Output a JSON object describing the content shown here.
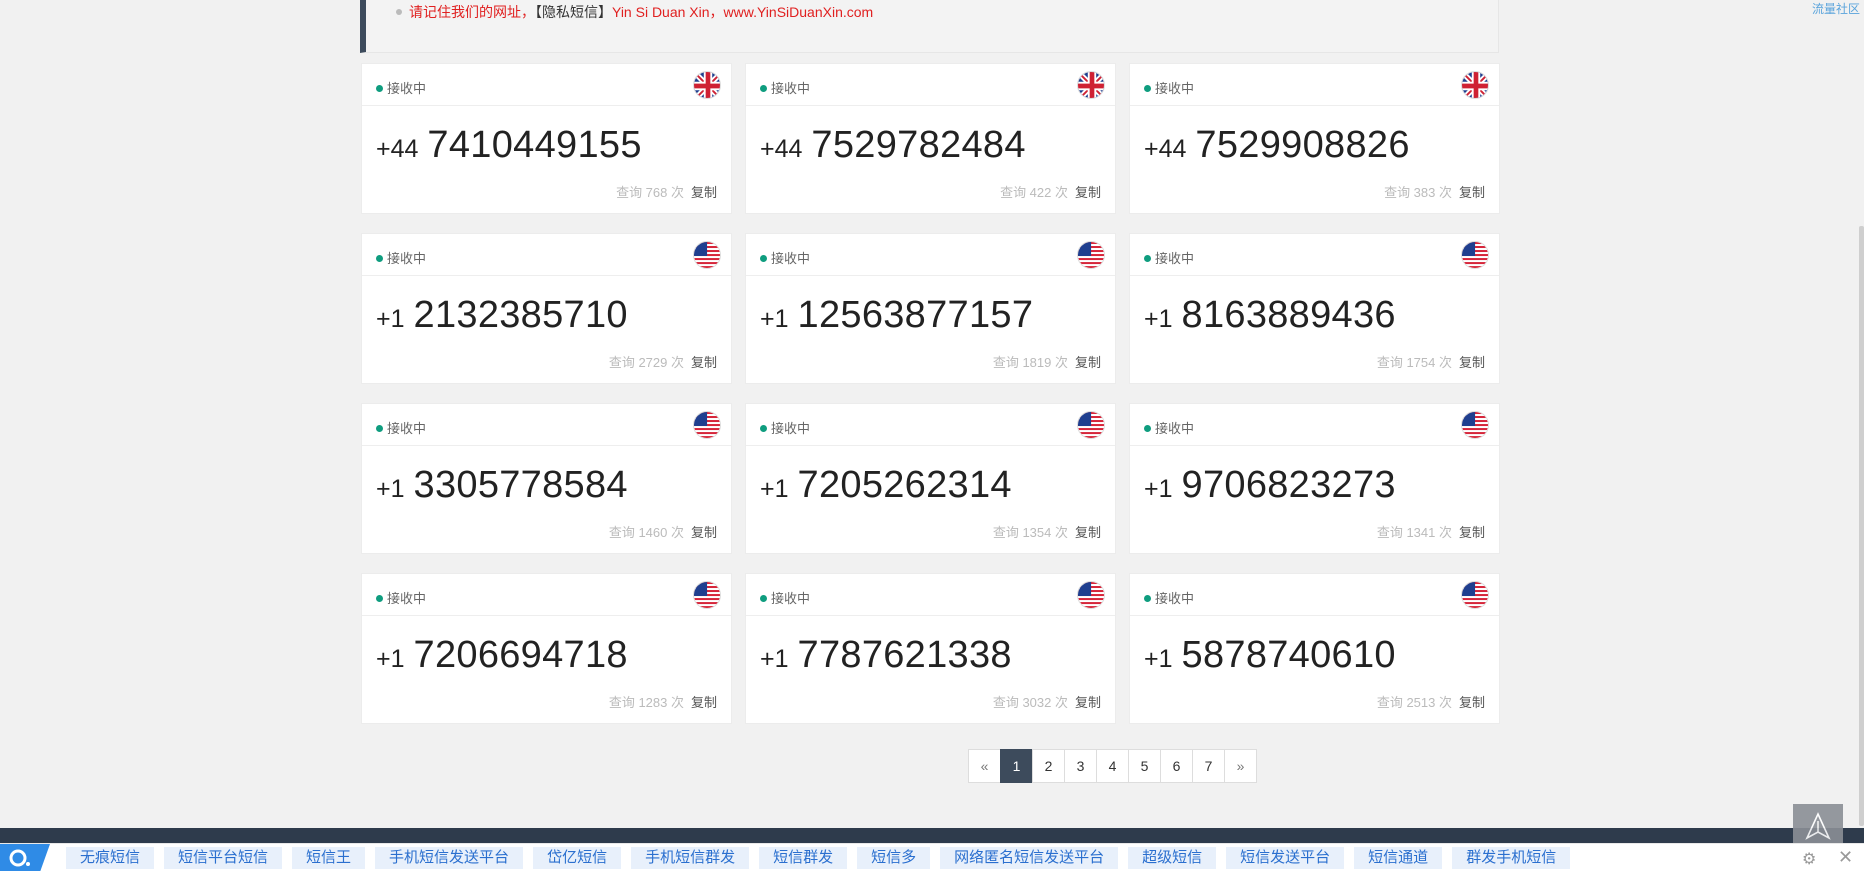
{
  "notice": {
    "prefix": "请记住我们的网址，",
    "brand": "【隐私短信】",
    "suffix": "Yin Si Duan Xin，www.YinSiDuanXin.com"
  },
  "side_link": "流量社区",
  "cards": [
    {
      "status": "接收中",
      "flag": "uk",
      "code": "+44",
      "number": "7410449155",
      "queries": "查询 768 次",
      "copy": "复制"
    },
    {
      "status": "接收中",
      "flag": "uk",
      "code": "+44",
      "number": "7529782484",
      "queries": "查询 422 次",
      "copy": "复制"
    },
    {
      "status": "接收中",
      "flag": "uk",
      "code": "+44",
      "number": "7529908826",
      "queries": "查询 383 次",
      "copy": "复制"
    },
    {
      "status": "接收中",
      "flag": "us",
      "code": "+1",
      "number": "2132385710",
      "queries": "查询 2729 次",
      "copy": "复制"
    },
    {
      "status": "接收中",
      "flag": "us",
      "code": "+1",
      "number": "12563877157",
      "queries": "查询 1819 次",
      "copy": "复制"
    },
    {
      "status": "接收中",
      "flag": "us",
      "code": "+1",
      "number": "8163889436",
      "queries": "查询 1754 次",
      "copy": "复制"
    },
    {
      "status": "接收中",
      "flag": "us",
      "code": "+1",
      "number": "3305778584",
      "queries": "查询 1460 次",
      "copy": "复制"
    },
    {
      "status": "接收中",
      "flag": "us",
      "code": "+1",
      "number": "7205262314",
      "queries": "查询 1354 次",
      "copy": "复制"
    },
    {
      "status": "接收中",
      "flag": "us",
      "code": "+1",
      "number": "9706823273",
      "queries": "查询 1341 次",
      "copy": "复制"
    },
    {
      "status": "接收中",
      "flag": "us",
      "code": "+1",
      "number": "7206694718",
      "queries": "查询 1283 次",
      "copy": "复制"
    },
    {
      "status": "接收中",
      "flag": "us",
      "code": "+1",
      "number": "7787621338",
      "queries": "查询 3032 次",
      "copy": "复制"
    },
    {
      "status": "接收中",
      "flag": "us",
      "code": "+1",
      "number": "5878740610",
      "queries": "查询 2513 次",
      "copy": "复制"
    }
  ],
  "pagination": {
    "prev": "«",
    "pages": [
      "1",
      "2",
      "3",
      "4",
      "5",
      "6",
      "7"
    ],
    "current": "1",
    "next": "»"
  },
  "adbar": {
    "links": [
      "无痕短信",
      "短信平台短信",
      "短信王",
      "手机短信发送平台",
      "岱亿短信",
      "手机短信群发",
      "短信群发",
      "短信多",
      "网络匿名短信发送平台",
      "超级短信",
      "短信发送平台",
      "短信通道",
      "群发手机短信"
    ],
    "gear_icon": "gear-icon",
    "close_icon": "close-icon"
  },
  "colors": {
    "accent": "#3d4b5c",
    "status_dot": "#0f9d7f",
    "notice_text": "#e02020",
    "ad_link": "#2a6fcf"
  }
}
